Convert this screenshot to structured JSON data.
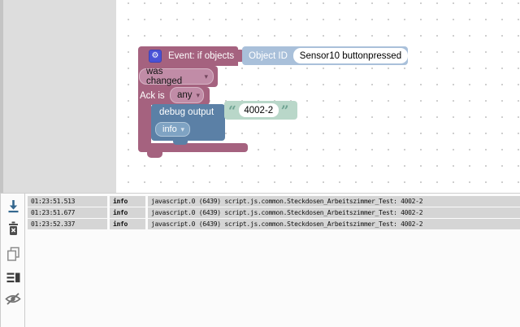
{
  "workspace": {
    "event_block": {
      "gear_icon": "⚙",
      "title": "Event: if objects",
      "object_label": "Object ID",
      "object_value": "Sensor10 buttonpressed",
      "change_select": "was changed",
      "ack_label": "Ack is",
      "ack_select": "any",
      "dropdown_arrow": "▾"
    },
    "debug_block": {
      "label": "debug output",
      "open_quote": "“",
      "close_quote": "”",
      "value": "4002-2",
      "level_select": "info",
      "dropdown_arrow": "▾"
    }
  },
  "log": {
    "entries": [
      {
        "time": "01:23:51.513",
        "level": "info",
        "message": "javascript.0 (6439) script.js.common.Steckdosen_Arbeitszimmer_Test: 4002-2"
      },
      {
        "time": "01:23:51.677",
        "level": "info",
        "message": "javascript.0 (6439) script.js.common.Steckdosen_Arbeitszimmer_Test: 4002-2"
      },
      {
        "time": "01:23:52.337",
        "level": "info",
        "message": "javascript.0 (6439) script.js.common.Steckdosen_Arbeitszimmer_Test: 4002-2"
      }
    ]
  },
  "colors": {
    "event_block": "#a5627f",
    "event_dropdown": "#c18ca7",
    "object_block": "#a9c0da",
    "debug_block": "#5b80a6",
    "debug_dropdown": "#7fa3c3",
    "text_block": "#b9d7c9",
    "gear_badge": "#4a52d6",
    "toolbox_bg": "#dddddd",
    "log_cell": "#d5d5d5",
    "scroll_icon": "#35688f"
  }
}
